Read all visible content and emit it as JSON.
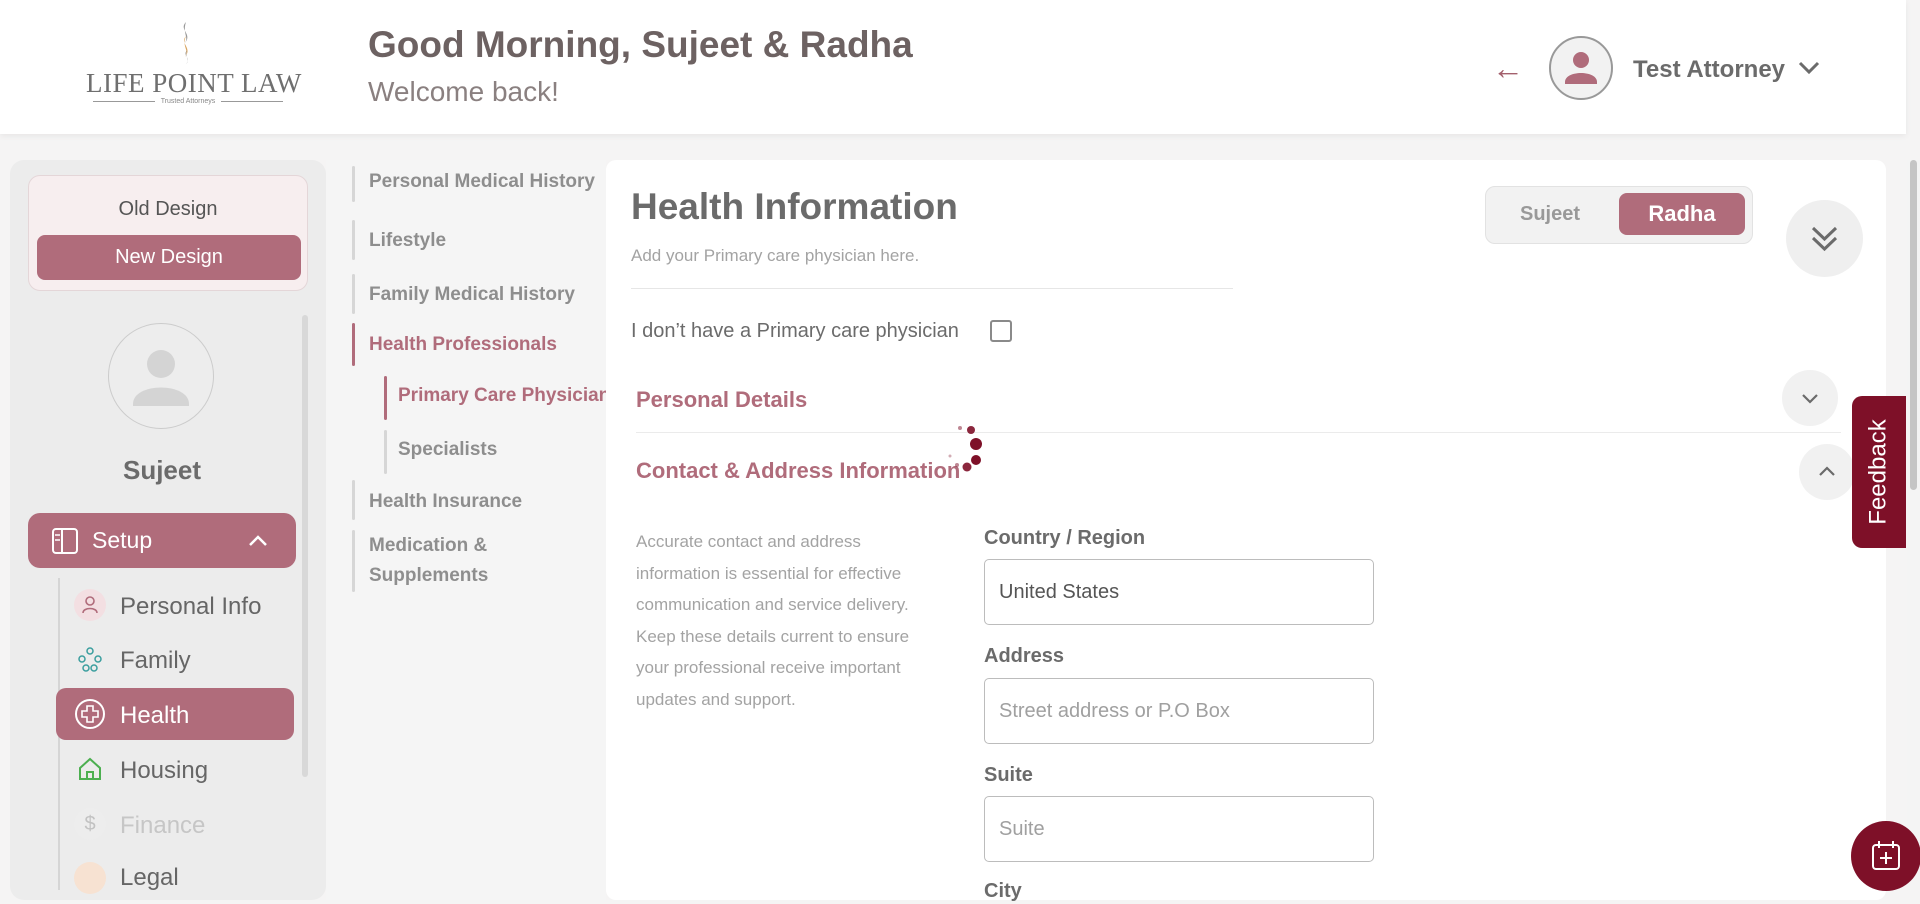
{
  "brand": {
    "name": "LIFE POINT LAW",
    "tagline": "Trusted Attorneys"
  },
  "header": {
    "greeting": "Good Morning, Sujeet & Radha",
    "welcome": "Welcome back!",
    "user_name": "Test Attorney",
    "back_icon": "arrow-left-icon"
  },
  "sidebar": {
    "old_design": "Old Design",
    "new_design": "New Design",
    "profile_name": "Sujeet",
    "setup_label": "Setup",
    "items": [
      {
        "label": "Personal Info",
        "icon": "person-icon",
        "active": false
      },
      {
        "label": "Family",
        "icon": "family-icon",
        "active": false
      },
      {
        "label": "Health",
        "icon": "health-plus-icon",
        "active": true
      },
      {
        "label": "Housing",
        "icon": "house-icon",
        "active": false
      },
      {
        "label": "Finance",
        "icon": "dollar-icon",
        "active": false
      },
      {
        "label": "Legal",
        "icon": "legal-icon",
        "active": false
      }
    ]
  },
  "subnav": {
    "items": [
      "Personal Medical History",
      "Lifestyle",
      "Family Medical History",
      "Health Professionals",
      "Primary Care Physician",
      "Specialists",
      "Health Insurance",
      "Medication &",
      "Supplements"
    ]
  },
  "main": {
    "title": "Health Information",
    "subtitle": "Add your Primary care physician here.",
    "no_pcp_label": "I don’t have a Primary care physician",
    "toggle": {
      "left": "Sujeet",
      "right": "Radha",
      "selected": "Radha"
    },
    "section_personal": "Personal Details",
    "section_contact": "Contact & Address Information",
    "contact_description": "Accurate contact and address information is essential for effective communication and service delivery. Keep these details current to ensure your professional receive important updates and support.",
    "fields": {
      "country_label": "Country / Region",
      "country_value": "United States",
      "address_label": "Address",
      "address_placeholder": "Street address or P.O Box",
      "suite_label": "Suite",
      "suite_placeholder": "Suite",
      "city_label": "City"
    }
  },
  "feedback_label": "Feedback",
  "colors": {
    "accent": "#b06c7b",
    "dark_accent": "#7e1028",
    "text": "#6b6b6b"
  }
}
